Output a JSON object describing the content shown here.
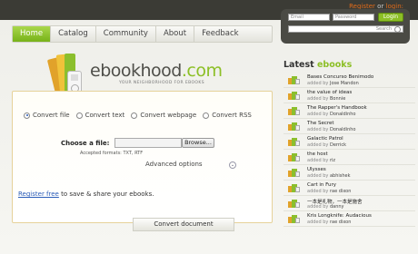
{
  "header": {
    "register_label": "Register",
    "or_label": "or",
    "login_label": "login:",
    "email_placeholder": "Email",
    "password_placeholder": "Password",
    "login_button": "Login",
    "search_placeholder": "Search"
  },
  "nav": {
    "items": [
      {
        "label": "Home"
      },
      {
        "label": "Catalog"
      },
      {
        "label": "Community"
      },
      {
        "label": "About"
      },
      {
        "label": "Feedback"
      }
    ],
    "active": "Home"
  },
  "logo": {
    "brand": "ebookhood",
    "tld": ".com",
    "tagline": "YOUR NEIGHBORHOOD FOR EBOOKS"
  },
  "converter": {
    "modes": [
      {
        "label": "Convert file",
        "selected": true
      },
      {
        "label": "Convert text",
        "selected": false
      },
      {
        "label": "Convert webpage",
        "selected": false
      },
      {
        "label": "Convert RSS",
        "selected": false
      }
    ],
    "choose_file_label": "Choose a file:",
    "browse_label": "Browse...",
    "accepted_formats": "Accepted formats: TXT, RTF",
    "advanced_options_label": "Advanced options",
    "register_link": "Register free",
    "register_suffix": "to save & share your ebooks.",
    "convert_button": "Convert document"
  },
  "latest": {
    "title_prefix": "Latest",
    "title_suffix": "ebooks",
    "added_by_label": "added by",
    "items": [
      {
        "title": "Bases Concurso Benimodo",
        "author": "Jose Mandon"
      },
      {
        "title": "the value of ideas",
        "author": "Bonnie"
      },
      {
        "title": "The Rapper's Handbook",
        "author": "Donaldinho"
      },
      {
        "title": "The Secret",
        "author": "Donaldinho"
      },
      {
        "title": "Galactic Patrol",
        "author": "Derrick"
      },
      {
        "title": "the host",
        "author": "riz"
      },
      {
        "title": "Ulysses",
        "author": "abhishek"
      },
      {
        "title": "Cart in Fury",
        "author": "rae dixon"
      },
      {
        "title": "一本是礼物，一本是施舍",
        "author": "danny"
      },
      {
        "title": "Kris Longknife: Audacious",
        "author": "rae dixon"
      }
    ]
  },
  "colors": {
    "accent_green": "#8cbf26",
    "link_orange": "#e06b1a",
    "link_blue": "#2a5cb8"
  }
}
